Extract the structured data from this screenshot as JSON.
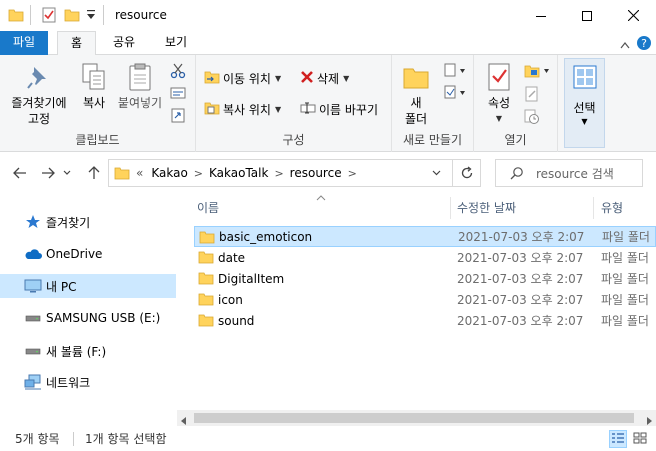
{
  "window": {
    "title": "resource"
  },
  "ribbon_tabs": {
    "file": "파일",
    "home": "홈",
    "share": "공유",
    "view": "보기"
  },
  "ribbon": {
    "clipboard": {
      "pin": "즐겨찾기에\n고정",
      "pin_l1": "즐겨찾기에",
      "pin_l2": "고정",
      "copy": "복사",
      "paste": "붙여넣기",
      "label": "클립보드"
    },
    "organize": {
      "move_to": "이동 위치",
      "copy_to": "복사 위치",
      "delete": "삭제",
      "rename": "이름 바꾸기",
      "label": "구성"
    },
    "new": {
      "new_folder_l1": "새",
      "new_folder_l2": "폴더",
      "label": "새로 만들기"
    },
    "open": {
      "properties": "속성",
      "label": "열기"
    },
    "select": {
      "select": "선택"
    }
  },
  "address": {
    "crumbs": [
      "«",
      "Kakao",
      "KakaoTalk",
      "resource"
    ]
  },
  "search": {
    "placeholder": "resource 검색"
  },
  "nav_pane": {
    "items": [
      {
        "label": "즐겨찾기",
        "icon": "star-icon"
      },
      {
        "label": "OneDrive",
        "icon": "cloud-icon"
      },
      {
        "label": "내 PC",
        "icon": "computer-icon",
        "selected": true
      },
      {
        "label": "SAMSUNG USB (E:)",
        "icon": "usb-drive-icon"
      },
      {
        "label": "새 볼륨 (F:)",
        "icon": "drive-icon"
      },
      {
        "label": "네트워크",
        "icon": "network-icon"
      }
    ]
  },
  "columns": {
    "name": "이름",
    "date": "수정한 날짜",
    "type": "유형"
  },
  "files": [
    {
      "name": "basic_emoticon",
      "date": "2021-07-03 오후 2:07",
      "type": "파일 폴더",
      "selected": true
    },
    {
      "name": "date",
      "date": "2021-07-03 오후 2:07",
      "type": "파일 폴더"
    },
    {
      "name": "DigitalItem",
      "date": "2021-07-03 오후 2:07",
      "type": "파일 폴더"
    },
    {
      "name": "icon",
      "date": "2021-07-03 오후 2:07",
      "type": "파일 폴더"
    },
    {
      "name": "sound",
      "date": "2021-07-03 오후 2:07",
      "type": "파일 폴더"
    }
  ],
  "status": {
    "count": "5개 항목",
    "selected": "1개 항목 선택함"
  },
  "colors": {
    "accent": "#1979ca",
    "selection": "#cce8ff",
    "folder": "#ffd35c"
  }
}
